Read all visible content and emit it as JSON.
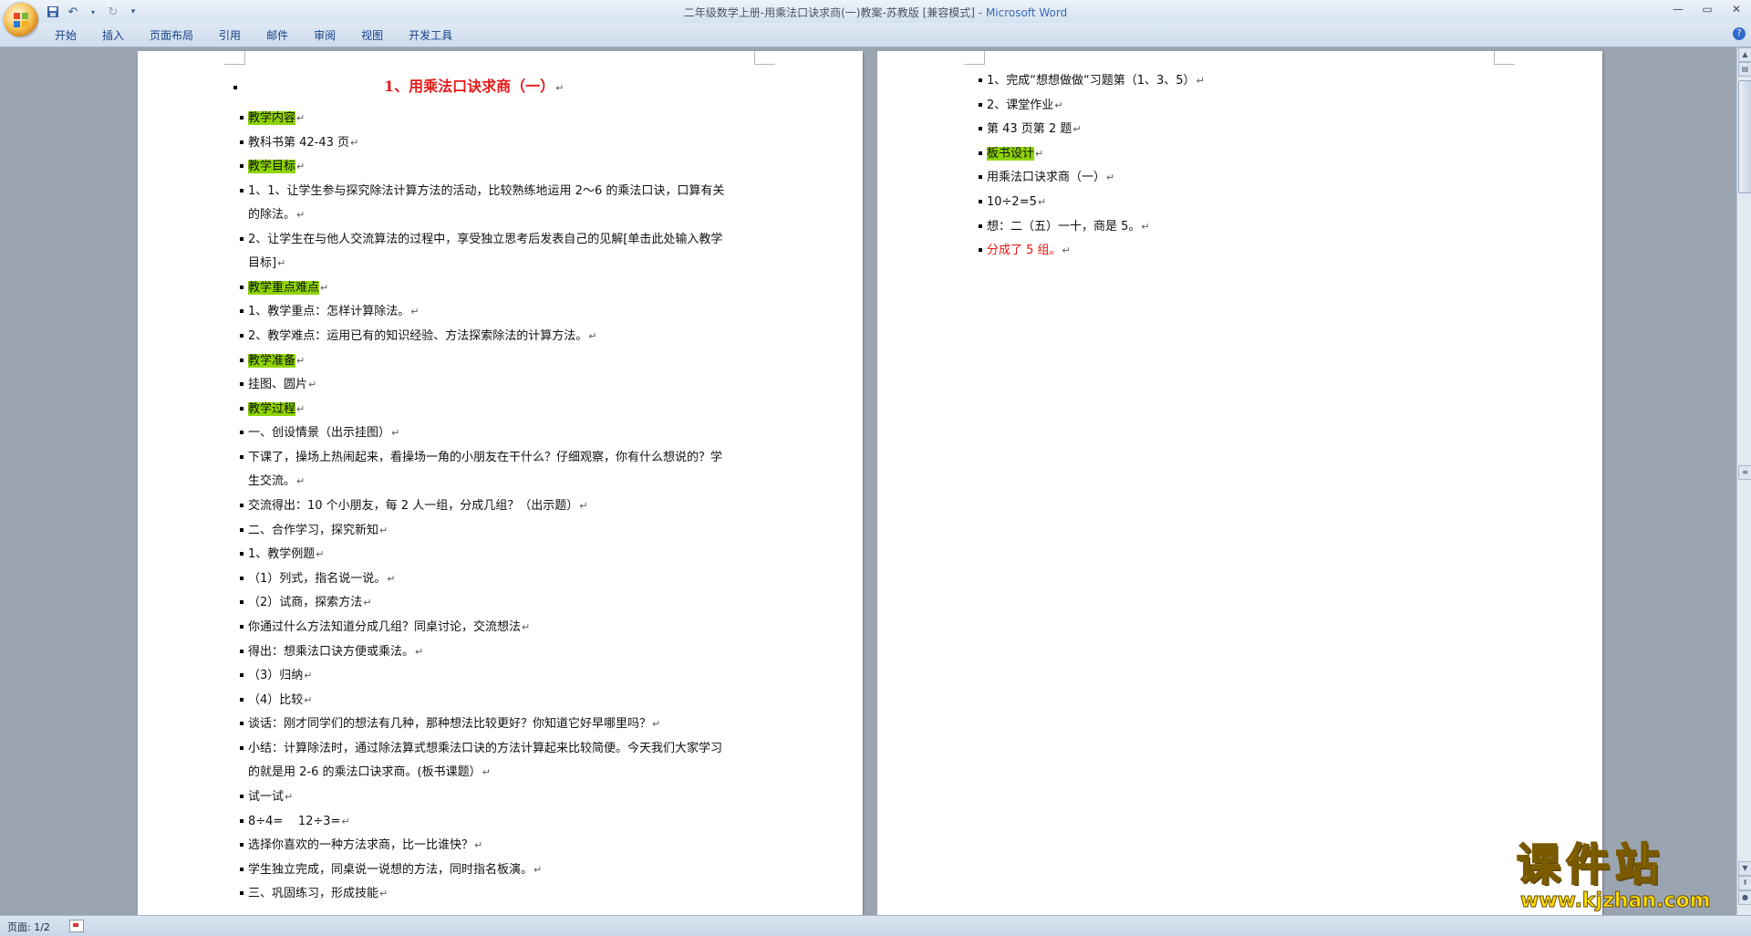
{
  "window": {
    "title_doc": "二年级数学上册-用乘法口诀求商(一)教案-苏教版 [兼容模式] - ",
    "title_app": "Microsoft Word"
  },
  "qat": {
    "save_icon": "save-icon",
    "undo_icon": "undo-icon",
    "redo_icon": "redo-icon",
    "customize": "▾"
  },
  "ribbon": {
    "tabs": [
      "开始",
      "插入",
      "页面布局",
      "引用",
      "邮件",
      "审阅",
      "视图",
      "开发工具"
    ]
  },
  "page1": {
    "title": "1、用乘法口诀求商（一）",
    "lines": [
      "教学内容",
      "教科书第 42-43 页",
      "教学目标",
      "1、1、让学生参与探究除法计算方法的活动，比较熟练地运用 2～6 的乘法口诀，口算有关",
      "的除法。",
      "2、让学生在与他人交流算法的过程中，享受独立思考后发表自己的见解[单击此处输入教学",
      "目标]",
      "教学重点难点",
      "1、教学重点：怎样计算除法。",
      "2、教学难点：运用已有的知识经验、方法探索除法的计算方法。",
      "教学准备",
      "挂图、圆片",
      "教学过程",
      "一、创设情景（出示挂图）",
      "下课了，操场上热闹起来，看操场一角的小朋友在干什么？仔细观察，你有什么想说的？学",
      "生交流。",
      "交流得出：10 个小朋友，每 2 人一组，分成几组？（出示题）",
      "二、合作学习，探究新知",
      "1、教学例题",
      "（1）列式，指名说一说。",
      "（2）试商，探索方法",
      "你通过什么方法知道分成几组？同桌讨论，交流想法",
      "得出：想乘法口诀方便或乘法。",
      "（3）归纳",
      "（4）比较",
      " 谈话：刚才同学们的想法有几种，那种想法比较更好？你知道它好早哪里吗？",
      "小结：计算除法时，通过除法算式想乘法口诀的方法计算起来比较简便。今天我们大家学习",
      "的就是用 2-6 的乘法口诀求商。(板书课题）",
      "试一试",
      "8÷4=    12÷3=",
      "选择你喜欢的一种方法求商，比一比谁快？",
      "学生独立完成，同桌说一说想的方法，同时指名板演。",
      "三、巩固练习，形成技能"
    ]
  },
  "page2": {
    "lines": [
      "1、完成“想想做做“习题第（1、3、5）",
      "2、课堂作业",
      "第 43 页第 2 题",
      "板书设计",
      "用乘法口诀求商（一）",
      "10÷2=5",
      "想：二（五）一十，商是 5。",
      "分成了 5 组。"
    ]
  },
  "status": {
    "page": "页面: 1/2"
  },
  "watermark": {
    "title": "课件站",
    "url": "www.kjzhan.com"
  },
  "colors": {
    "highlight": "#8ed400",
    "title_red": "#e61a1a",
    "accent_blue": "#3b6ab8"
  }
}
